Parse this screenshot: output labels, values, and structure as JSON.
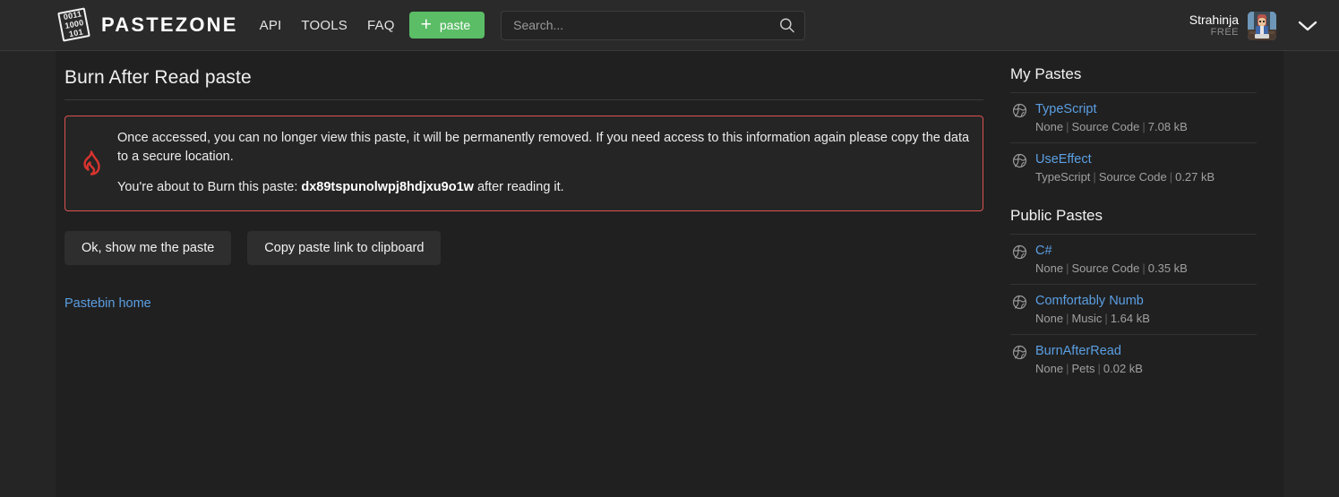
{
  "header": {
    "logo": {
      "icon": "binary-sheet-logo-icon",
      "bits": [
        "0011",
        "1000",
        "101"
      ]
    },
    "brand_name": "PASTEZONE",
    "nav": [
      {
        "label": "API",
        "name": "nav-api"
      },
      {
        "label": "TOOLS",
        "name": "nav-tools"
      },
      {
        "label": "FAQ",
        "name": "nav-faq"
      }
    ],
    "paste_button": {
      "label": "paste",
      "icon": "plus-icon",
      "color": "#5bbd66"
    },
    "search": {
      "placeholder": "Search...",
      "value": "",
      "icon": "search-icon"
    },
    "user": {
      "name": "Strahinja",
      "plan": "FREE",
      "avatar_icon": "user-avatar",
      "chevron_icon": "chevron-down-icon"
    }
  },
  "main": {
    "title": "Burn After Read paste",
    "alert": {
      "icon": "flame-icon",
      "border_color": "#d9534f",
      "line1": "Once accessed, you can no longer view this paste, it will be permanently removed. If you need access to this information again please copy the data to a secure location.",
      "line2_prefix": "You're about to Burn this paste: ",
      "paste_id": "dx89tspunolwpj8hdjxu9o1w",
      "line2_suffix": " after reading it."
    },
    "buttons": [
      {
        "label": "Ok, show me the paste",
        "name": "show-paste-button"
      },
      {
        "label": "Copy paste link to clipboard",
        "name": "copy-link-button"
      }
    ],
    "home_link": "Pastebin home"
  },
  "sidebar": {
    "my_pastes_heading": "My Pastes",
    "my_pastes": [
      {
        "name": "TypeScript",
        "language": "None",
        "category": "Source Code",
        "size": "7.08 kB",
        "icon": "globe-icon"
      },
      {
        "name": "UseEffect",
        "language": "TypeScript",
        "category": "Source Code",
        "size": "0.27 kB",
        "icon": "globe-icon"
      }
    ],
    "public_pastes_heading": "Public Pastes",
    "public_pastes": [
      {
        "name": "C#",
        "language": "None",
        "category": "Source Code",
        "size": "0.35 kB",
        "icon": "globe-icon"
      },
      {
        "name": "Comfortably Numb",
        "language": "None",
        "category": "Music",
        "size": "1.64 kB",
        "icon": "globe-icon"
      },
      {
        "name": "BurnAfterRead",
        "language": "None",
        "category": "Pets",
        "size": "0.02 kB",
        "icon": "globe-icon"
      }
    ]
  }
}
